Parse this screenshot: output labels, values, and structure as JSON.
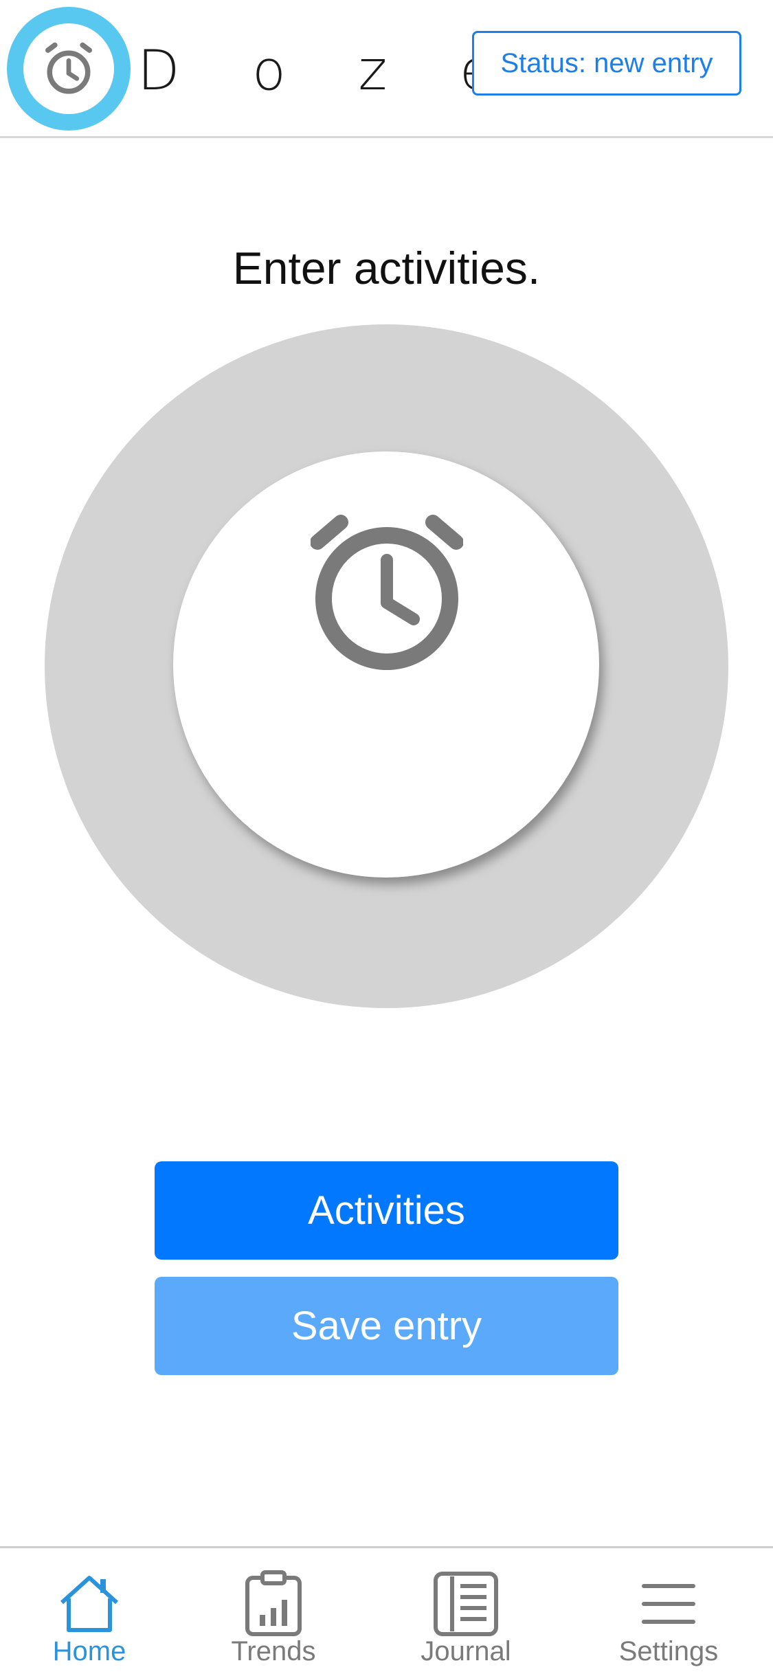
{
  "header": {
    "brand": "D o z e",
    "status_button_label": "Status: new entry"
  },
  "main": {
    "prompt": "Enter activities."
  },
  "buttons": {
    "activities_label": "Activities",
    "save_label": "Save entry"
  },
  "tabbar": {
    "tabs": [
      {
        "label": "Home",
        "icon": "home-icon",
        "active": true
      },
      {
        "label": "Trends",
        "icon": "clipboard-chart-icon",
        "active": false
      },
      {
        "label": "Journal",
        "icon": "journal-icon",
        "active": false
      },
      {
        "label": "Settings",
        "icon": "menu-icon",
        "active": false
      }
    ]
  },
  "colors": {
    "accent_blue": "#0278ff",
    "accent_light_blue": "#5aa9fb",
    "logo_ring": "#58c8f0",
    "active_tab": "#2b93dc",
    "ring_gray": "#d3d3d3",
    "icon_gray": "#7a7a7a"
  }
}
